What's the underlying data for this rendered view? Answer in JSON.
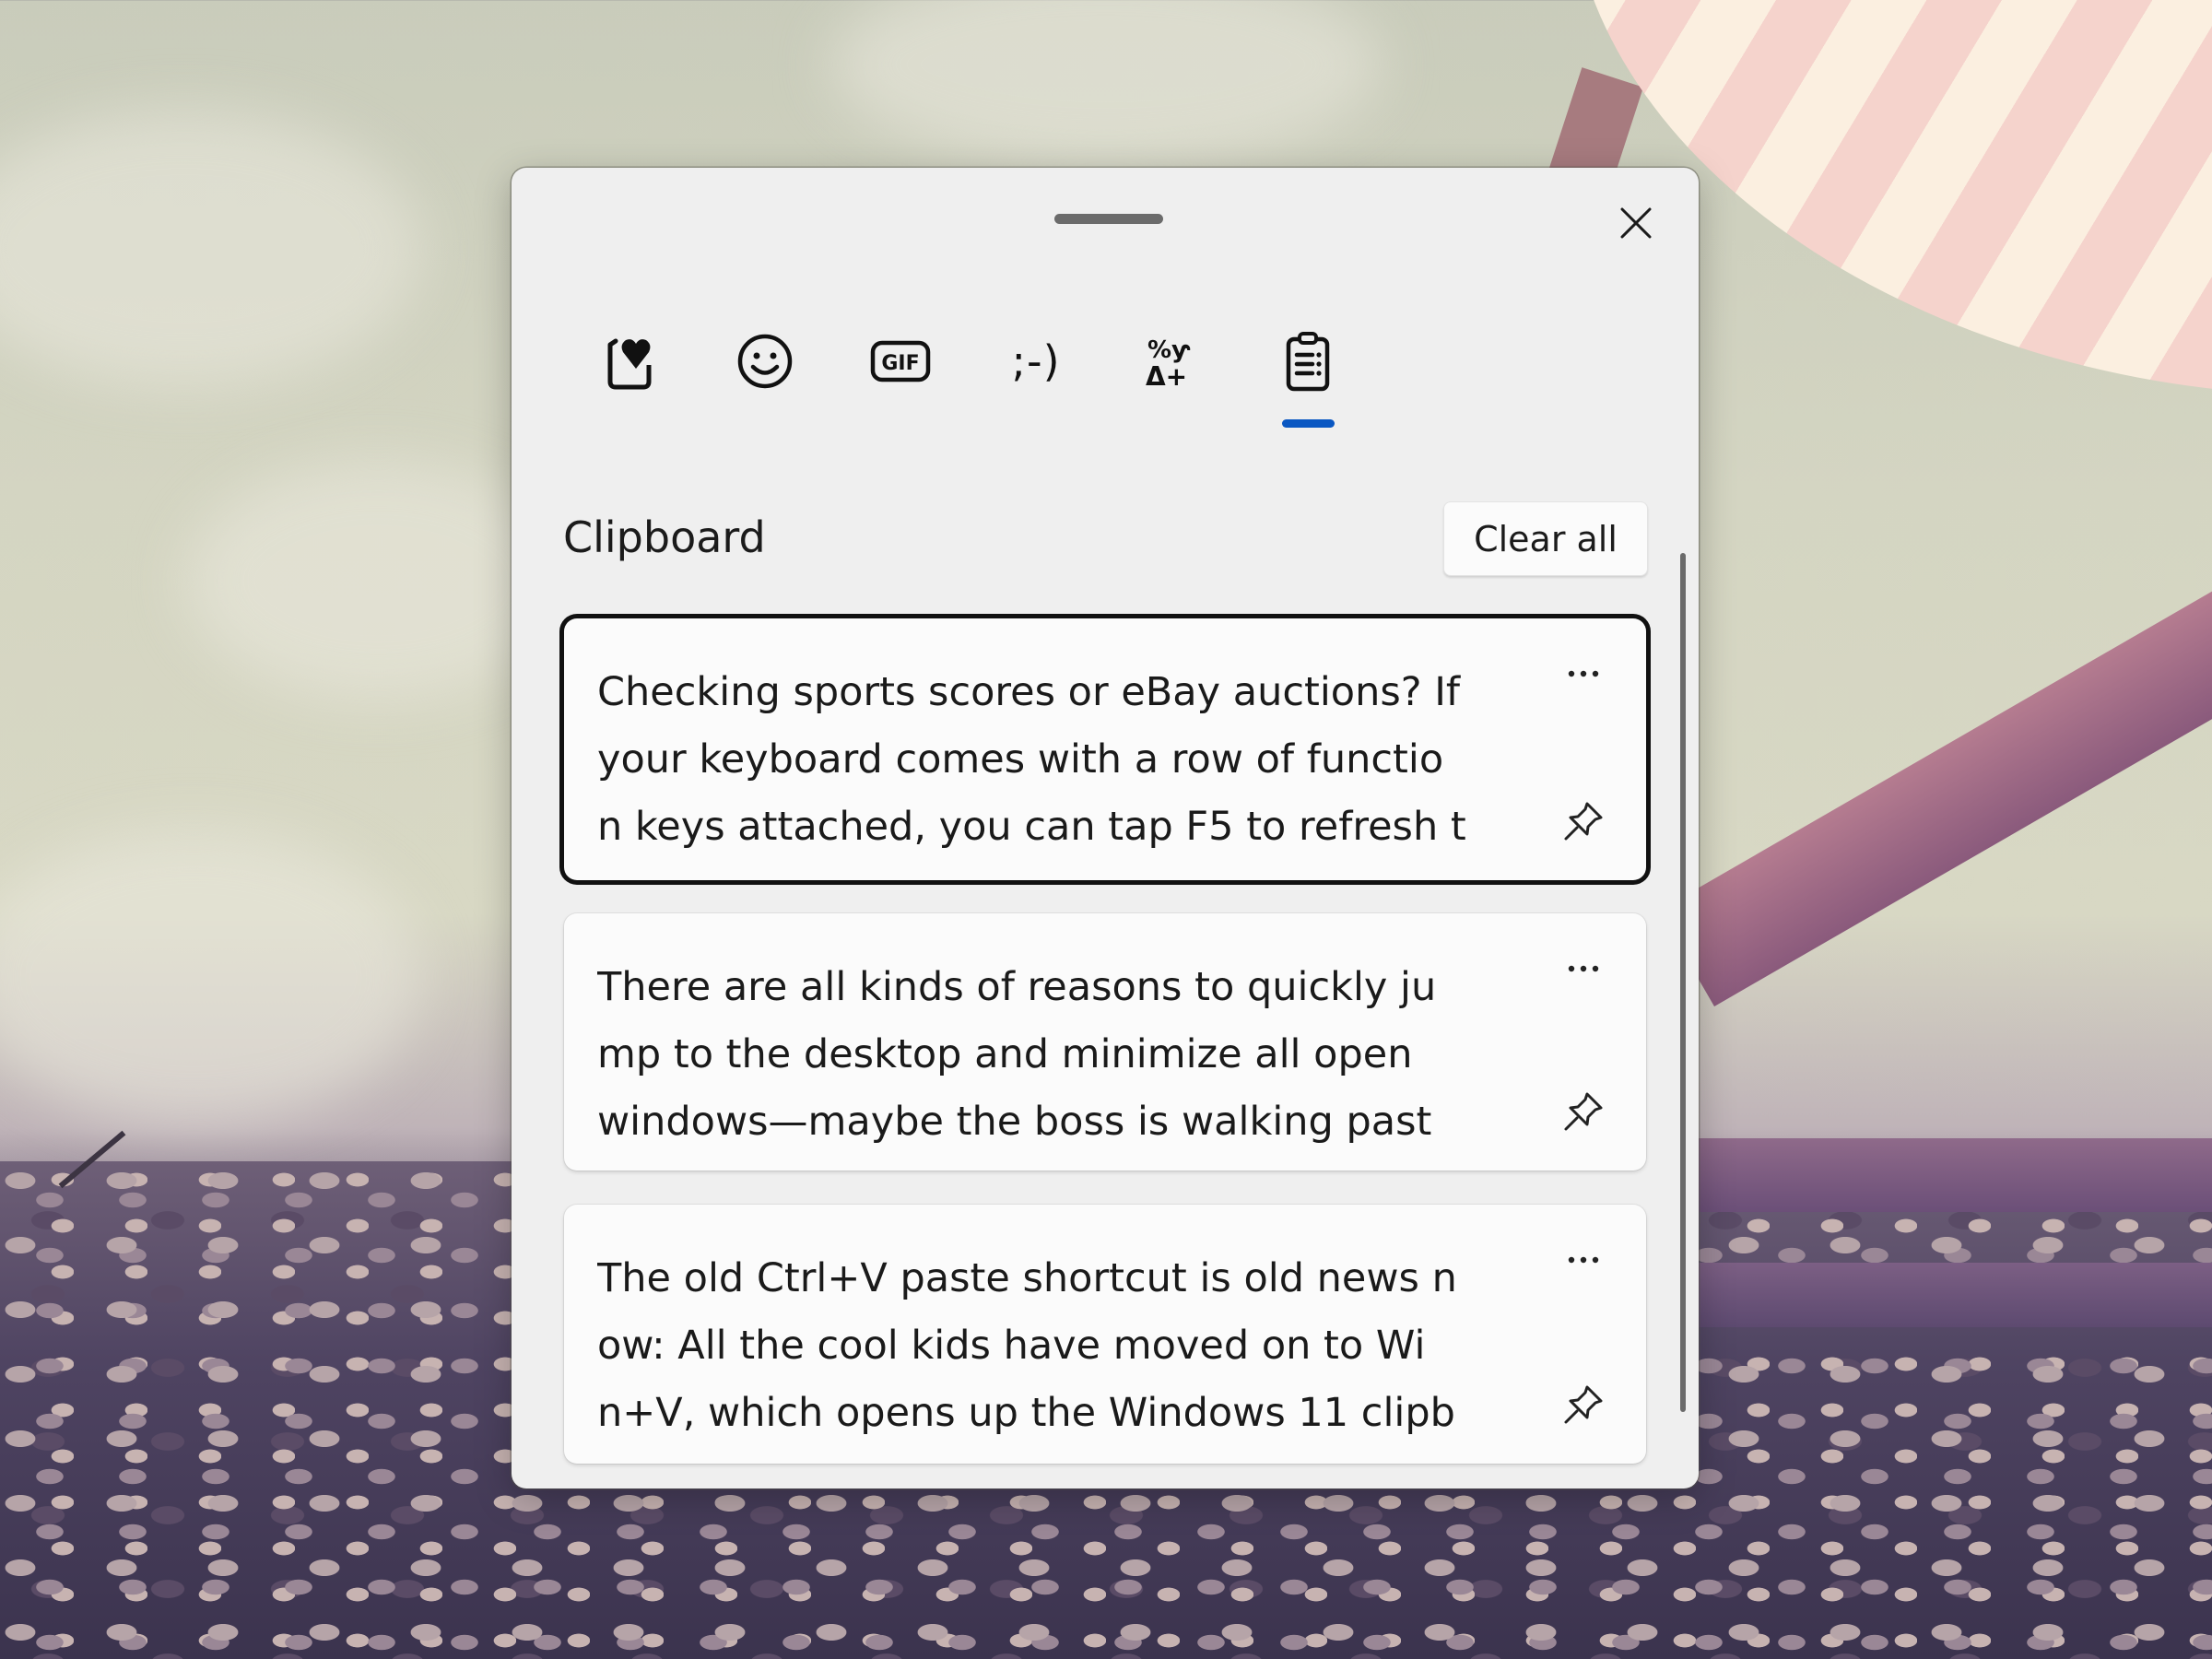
{
  "panel": {
    "title": "Clipboard",
    "clear_all_label": "Clear all",
    "close_icon": "close-icon",
    "drag_handle": "drag-handle"
  },
  "tabs": [
    {
      "id": "recently-used",
      "icon": "heart-clipboard-icon",
      "label": "Most recently used",
      "selected": false
    },
    {
      "id": "emoji",
      "icon": "smiley-icon",
      "label": "Emoji",
      "selected": false
    },
    {
      "id": "gif",
      "icon": "gif-icon",
      "label": "GIF",
      "glyph": "GIF",
      "selected": false
    },
    {
      "id": "kaomoji",
      "icon": "kaomoji-icon",
      "label": "Kaomoji",
      "glyph": ";-)",
      "selected": false
    },
    {
      "id": "symbols",
      "icon": "symbols-icon",
      "label": "Symbols",
      "glyph_top": "%ƴ",
      "glyph_bottom": "Δ+",
      "selected": false
    },
    {
      "id": "clipboard",
      "icon": "clipboard-icon",
      "label": "Clipboard history",
      "selected": true
    }
  ],
  "accent_color": "#0a57c2",
  "clipboard_items": [
    {
      "lines": [
        "Checking sports scores or eBay auctions? If",
        "your keyboard comes with a row of functio",
        "n keys attached, you can tap F5 to refresh t"
      ],
      "selected": true,
      "more_icon": "more-options-icon",
      "pin_icon": "pin-icon"
    },
    {
      "lines": [
        "There are all kinds of reasons to quickly ju",
        "mp to the desktop and minimize all open",
        "windows—maybe the boss is walking past"
      ],
      "selected": false,
      "more_icon": "more-options-icon",
      "pin_icon": "pin-icon"
    },
    {
      "lines": [
        "The old Ctrl+V paste shortcut is old news n",
        "ow: All the cool kids have moved on to Wi",
        "n+V, which opens up the Windows 11 clipb"
      ],
      "selected": false,
      "more_icon": "more-options-icon",
      "pin_icon": "pin-icon"
    }
  ]
}
